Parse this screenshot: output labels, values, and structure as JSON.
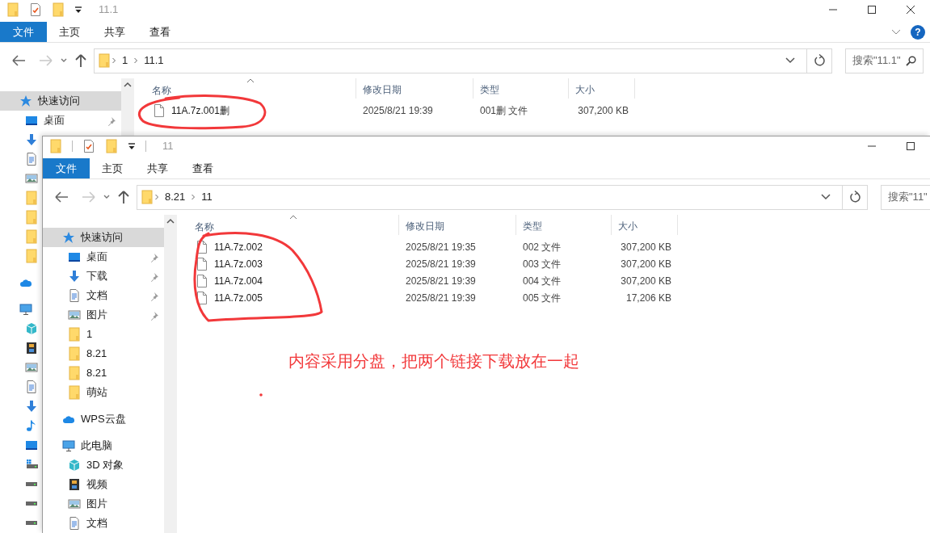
{
  "windows": [
    {
      "title": "11.1",
      "help": {
        "label": "?"
      },
      "ribbon_tabs": [
        {
          "label": "文件",
          "selected": true
        },
        {
          "label": "主页",
          "selected": false
        },
        {
          "label": "共享",
          "selected": false
        },
        {
          "label": "查看",
          "selected": false
        }
      ],
      "breadcrumb": [
        "1",
        "11.1"
      ],
      "search": {
        "placeholder": "搜索\"11.1\""
      },
      "nav": [
        {
          "kind": "star",
          "label": "快速访问",
          "selected": true,
          "children": [
            {
              "kind": "desktop",
              "label": "桌面",
              "pinned": true,
              "selected": false
            },
            {
              "kind": "download",
              "selected": false
            },
            {
              "kind": "document",
              "selected": false
            },
            {
              "kind": "picture",
              "selected": false
            },
            {
              "kind": "folder",
              "selected": false
            },
            {
              "kind": "folder",
              "selected": false
            },
            {
              "kind": "folder",
              "selected": false
            },
            {
              "kind": "folder",
              "selected": false
            }
          ]
        },
        {
          "kind": "cloud",
          "selected": false
        },
        {
          "kind": "pc",
          "selected": false,
          "children": [
            {
              "kind": "cube",
              "selected": false
            },
            {
              "kind": "film",
              "selected": false
            },
            {
              "kind": "picture",
              "selected": false
            },
            {
              "kind": "document",
              "selected": false
            },
            {
              "kind": "download",
              "selected": false
            },
            {
              "kind": "music",
              "selected": false
            },
            {
              "kind": "desktop",
              "selected": false
            },
            {
              "kind": "windrive",
              "selected": false
            },
            {
              "kind": "drive",
              "selected": false
            },
            {
              "kind": "drive",
              "selected": false
            },
            {
              "kind": "drive",
              "selected": false
            }
          ]
        }
      ],
      "columns": [
        "名称",
        "修改日期",
        "类型",
        "大小"
      ],
      "files": [
        {
          "name": "11A.7z.001删",
          "modified": "2025/8/21 19:39",
          "type": "001删 文件",
          "size": "307,200 KB"
        }
      ]
    },
    {
      "title": "11",
      "ribbon_tabs": [
        {
          "label": "文件",
          "selected": true
        },
        {
          "label": "主页",
          "selected": false
        },
        {
          "label": "共享",
          "selected": false
        },
        {
          "label": "查看",
          "selected": false
        }
      ],
      "breadcrumb": [
        "8.21",
        "11"
      ],
      "search": {
        "placeholder": "搜索\"11\""
      },
      "nav": [
        {
          "kind": "star",
          "label": "快速访问",
          "selected": true,
          "children": [
            {
              "kind": "desktop",
              "label": "桌面",
              "pinned": true,
              "selected": false
            },
            {
              "kind": "download",
              "label": "下载",
              "pinned": true,
              "selected": false
            },
            {
              "kind": "document",
              "label": "文档",
              "pinned": true,
              "selected": false
            },
            {
              "kind": "picture",
              "label": "图片",
              "pinned": true,
              "selected": false
            },
            {
              "kind": "folder",
              "label": "1",
              "pinned": false,
              "selected": false
            },
            {
              "kind": "folder",
              "label": "8.21",
              "pinned": false,
              "selected": false
            },
            {
              "kind": "folder",
              "label": "8.21",
              "pinned": false,
              "selected": false
            },
            {
              "kind": "folder",
              "label": "萌站",
              "pinned": false,
              "selected": false
            }
          ]
        },
        {
          "kind": "cloud",
          "label": "WPS云盘",
          "selected": false
        },
        {
          "kind": "pc",
          "label": "此电脑",
          "selected": false,
          "children": [
            {
              "kind": "cube",
              "label": "3D 对象",
              "pinned": false,
              "selected": false
            },
            {
              "kind": "film",
              "label": "视频",
              "pinned": false,
              "selected": false
            },
            {
              "kind": "picture",
              "label": "图片",
              "pinned": false,
              "selected": false
            },
            {
              "kind": "document",
              "label": "文档",
              "pinned": false,
              "selected": false
            }
          ]
        }
      ],
      "columns": [
        "名称",
        "修改日期",
        "类型",
        "大小"
      ],
      "files": [
        {
          "name": "11A.7z.002",
          "modified": "2025/8/21 19:35",
          "type": "002 文件",
          "size": "307,200 KB"
        },
        {
          "name": "11A.7z.003",
          "modified": "2025/8/21 19:39",
          "type": "003 文件",
          "size": "307,200 KB"
        },
        {
          "name": "11A.7z.004",
          "modified": "2025/8/21 19:39",
          "type": "004 文件",
          "size": "307,200 KB"
        },
        {
          "name": "11A.7z.005",
          "modified": "2025/8/21 19:39",
          "type": "005 文件",
          "size": "17,206 KB"
        }
      ]
    }
  ],
  "annotations": [
    {
      "kind": "circle"
    },
    {
      "kind": "circle"
    },
    {
      "kind": "note",
      "text": "内容采用分盘，把两个链接下载放在一起"
    },
    {
      "kind": "dot"
    }
  ]
}
